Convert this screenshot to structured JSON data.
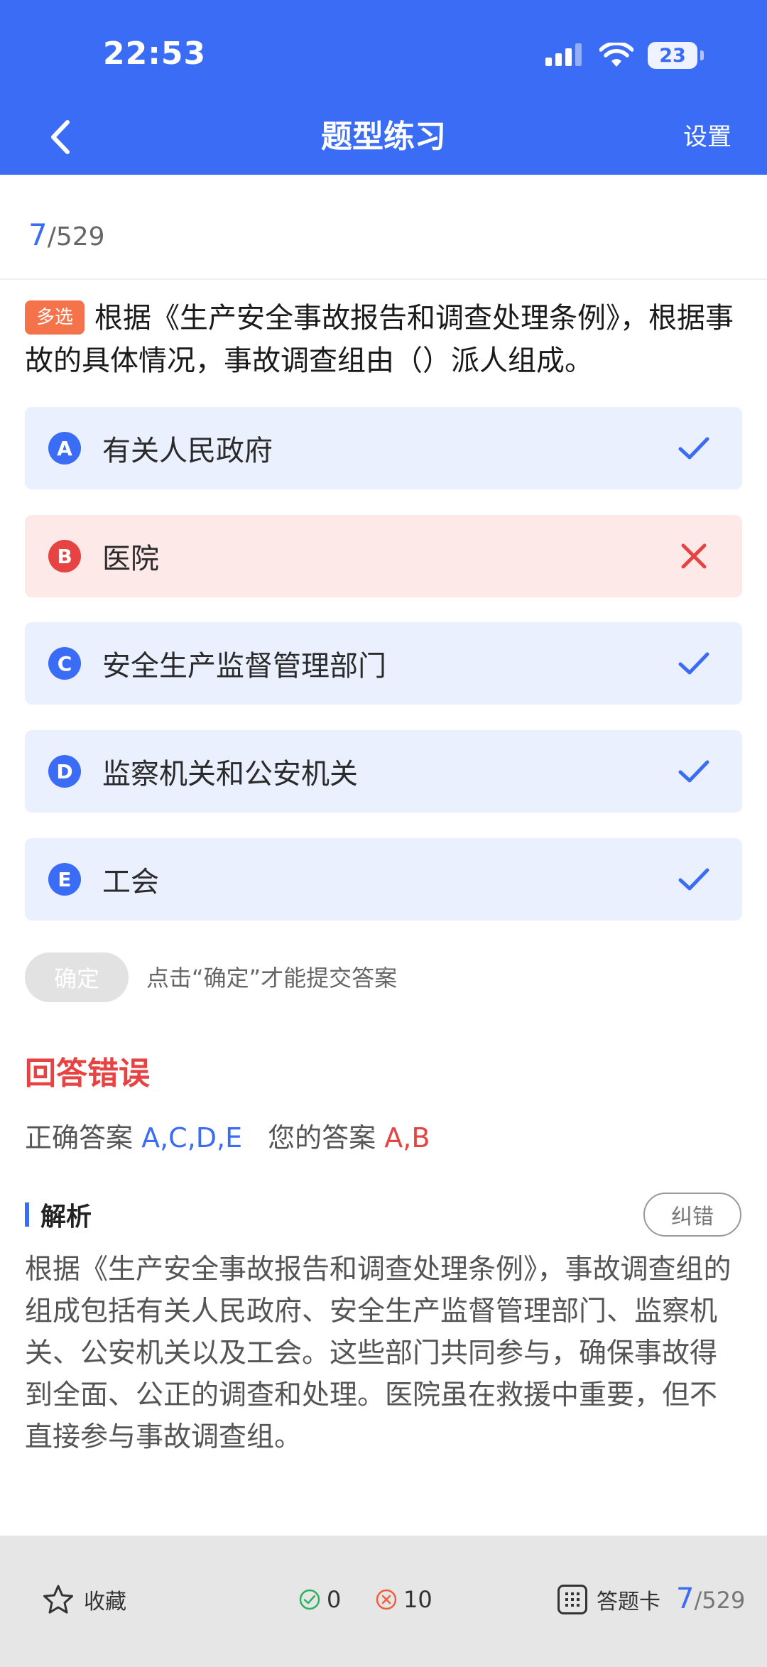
{
  "status_bar": {
    "time": "22:53",
    "battery": "23"
  },
  "header": {
    "title": "题型练习",
    "settings_label": "设置"
  },
  "progress": {
    "current": "7",
    "total": "/529"
  },
  "question": {
    "tag": "多选",
    "text": "根据《生产安全事故报告和调查处理条例》，根据事故的具体情况，事故调查组由（）派人组成。"
  },
  "options": [
    {
      "letter": "A",
      "text": "有关人民政府",
      "state": "correct"
    },
    {
      "letter": "B",
      "text": "医院",
      "state": "wrong"
    },
    {
      "letter": "C",
      "text": "安全生产监督管理部门",
      "state": "correct"
    },
    {
      "letter": "D",
      "text": "监察机关和公安机关",
      "state": "correct"
    },
    {
      "letter": "E",
      "text": "工会",
      "state": "correct"
    }
  ],
  "confirm": {
    "label": "确定",
    "hint": "点击“确定”才能提交答案"
  },
  "result": {
    "title": "回答错误",
    "correct_label": "正确答案",
    "correct_value": "A,C,D,E",
    "user_label": "您的答案",
    "user_value": "A,B"
  },
  "analysis": {
    "title": "解析",
    "report_label": "纠错",
    "text": "根据《生产安全事故报告和调查处理条例》，事故调查组的组成包括有关人民政府、安全生产监督管理部门、监察机关、公安机关以及工会。这些部门共同参与，确保事故得到全面、公正的调查和处理。医院虽在救援中重要，但不直接参与事故调查组。"
  },
  "bottom_bar": {
    "favorite_label": "收藏",
    "right_count": "0",
    "wrong_count": "10",
    "card_label": "答题卡",
    "current": "7",
    "total": "/529"
  },
  "colors": {
    "primary": "#3b6cf6",
    "error": "#e84343",
    "tag": "#f5734a",
    "correct_bg": "#eaf0fd",
    "wrong_bg": "#fde9e8"
  }
}
